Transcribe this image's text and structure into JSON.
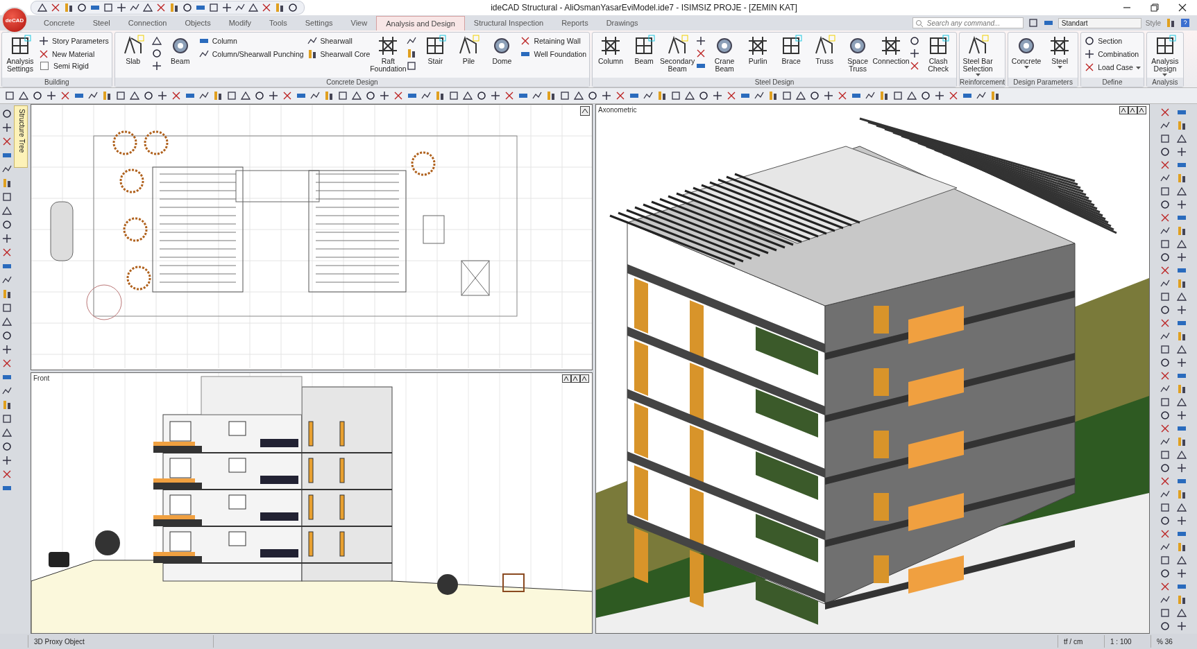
{
  "window": {
    "logo": "deCAD",
    "title": "ideCAD Structural - AliOsmanYasarEviModel.ide7 - ISIMSIZ PROJE - [ZEMIN KAT]"
  },
  "tabs": [
    {
      "label": "Concrete",
      "selected": false
    },
    {
      "label": "Steel",
      "selected": false
    },
    {
      "label": "Connection",
      "selected": false
    },
    {
      "label": "Objects",
      "selected": false
    },
    {
      "label": "Modify",
      "selected": false
    },
    {
      "label": "Tools",
      "selected": false
    },
    {
      "label": "Settings",
      "selected": false
    },
    {
      "label": "View",
      "selected": false
    },
    {
      "label": "Analysis and Design",
      "selected": true
    },
    {
      "label": "Structural Inspection",
      "selected": false
    },
    {
      "label": "Reports",
      "selected": false
    },
    {
      "label": "Drawings",
      "selected": false
    }
  ],
  "search": {
    "placeholder": "Search any command..."
  },
  "style_box": {
    "value": "Standart",
    "label": "Style"
  },
  "ribbon": [
    {
      "name": "Building",
      "items": [
        {
          "kind": "large",
          "label": "Analysis Settings"
        },
        {
          "kind": "column",
          "children": [
            {
              "kind": "small",
              "label": "Story Parameters"
            },
            {
              "kind": "small",
              "label": "New Material"
            },
            {
              "kind": "check",
              "label": "Semi Rigid",
              "checked": false
            }
          ]
        }
      ]
    },
    {
      "name": "Concrete Design",
      "items": [
        {
          "kind": "large",
          "label": "Slab"
        },
        {
          "kind": "icon-stack"
        },
        {
          "kind": "large",
          "label": "Beam"
        },
        {
          "kind": "column",
          "children": [
            {
              "kind": "small",
              "label": "Column"
            },
            {
              "kind": "small",
              "label": "Column/Shearwall Punching"
            }
          ]
        },
        {
          "kind": "column",
          "children": [
            {
              "kind": "small",
              "label": "Shearwall"
            },
            {
              "kind": "small",
              "label": "Shearwall Core"
            }
          ]
        },
        {
          "kind": "large",
          "label": "Raft Foundation"
        },
        {
          "kind": "icon-stack"
        },
        {
          "kind": "large",
          "label": "Stair"
        },
        {
          "kind": "large",
          "label": "Pile"
        },
        {
          "kind": "large",
          "label": "Dome"
        },
        {
          "kind": "column",
          "children": [
            {
              "kind": "small",
              "label": "Retaining Wall"
            },
            {
              "kind": "small",
              "label": "Well Foundation"
            }
          ]
        }
      ]
    },
    {
      "name": "Steel Design",
      "items": [
        {
          "kind": "large",
          "label": "Column"
        },
        {
          "kind": "large",
          "label": "Beam"
        },
        {
          "kind": "large",
          "label": "Secondary Beam"
        },
        {
          "kind": "icon-stack"
        },
        {
          "kind": "large",
          "label": "Crane Beam"
        },
        {
          "kind": "large",
          "label": "Purlin"
        },
        {
          "kind": "large",
          "label": "Brace"
        },
        {
          "kind": "large",
          "label": "Truss"
        },
        {
          "kind": "large",
          "label": "Space Truss"
        },
        {
          "kind": "large",
          "label": "Connection"
        },
        {
          "kind": "icon-stack"
        },
        {
          "kind": "large",
          "label": "Clash Check"
        }
      ]
    },
    {
      "name": "Reinforcement",
      "items": [
        {
          "kind": "large",
          "label": "Steel Bar Selection",
          "dropdown": true
        }
      ]
    },
    {
      "name": "Design Parameters",
      "items": [
        {
          "kind": "large",
          "label": "Concrete",
          "dropdown": true
        },
        {
          "kind": "large",
          "label": "Steel",
          "dropdown": true
        }
      ]
    },
    {
      "name": "Define",
      "items": [
        {
          "kind": "column",
          "children": [
            {
              "kind": "small",
              "label": "Section"
            },
            {
              "kind": "small",
              "label": "Combination"
            },
            {
              "kind": "small",
              "label": "Load Case",
              "dropdown": true
            }
          ]
        }
      ]
    },
    {
      "name": "Analysis",
      "items": [
        {
          "kind": "large",
          "label": "Analysis Design",
          "dropdown": true
        }
      ]
    }
  ],
  "side_tab": "Structure Tree",
  "viewports": {
    "front": "Front",
    "axonometric": "Axonometric"
  },
  "status_bar": {
    "message": "3D Proxy Object",
    "units": "tf / cm",
    "scale": "1 : 100",
    "zoom": "% 36"
  }
}
